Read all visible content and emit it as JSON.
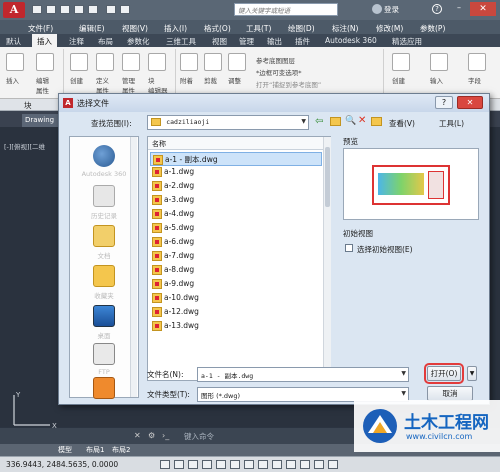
{
  "titlebar": {
    "search_placeholder": "键入关键字或短语",
    "login": "登录"
  },
  "menu": [
    "文件(F)",
    "编辑(E)",
    "视图(V)",
    "插入(I)",
    "格式(O)",
    "工具(T)",
    "绘图(D)",
    "标注(N)",
    "修改(M)",
    "参数(P)"
  ],
  "ribbon_tabs": [
    "默认",
    "插入",
    "注释",
    "布局",
    "参数化",
    "三维工具",
    "视图",
    "管理",
    "输出",
    "插件",
    "Autodesk 360",
    "精选应用"
  ],
  "ribbon_active_tab": "插入",
  "ribbon": {
    "insert": "插入",
    "edit_attr": "编辑\n属性",
    "create": "创建",
    "define_attr": "定义\n属性",
    "manage_attr": "管理\n属性",
    "block_editor": "块\n编辑器",
    "attach": "附着",
    "clip": "剪裁",
    "adjust": "调整",
    "ref_underlay": "参考底图图层",
    "frame_var": "*边框可变选项*",
    "import_text": "打开“捕捉到参考底图”",
    "create2": "创建",
    "import": "输入",
    "field": "字段"
  },
  "panel_block": "块",
  "doc_tab": "Drawing",
  "viewport_label": "[-][俯视][二维",
  "dialog": {
    "title": "选择文件",
    "lookin_label": "查找范围(I):",
    "lookin_value": "cadziliaoji",
    "view_label": "查看(V)",
    "tools_label": "工具(L)",
    "places": [
      {
        "label": "Autodesk 360",
        "icon": "cloud-icon"
      },
      {
        "label": "历史记录",
        "icon": "history-icon"
      },
      {
        "label": "文档",
        "icon": "documents-icon"
      },
      {
        "label": "收藏夹",
        "icon": "favorites-icon"
      },
      {
        "label": "桌面",
        "icon": "desktop-icon"
      },
      {
        "label": "FTP",
        "icon": "ftp-icon"
      }
    ],
    "list_header": "名称",
    "files": [
      "a-1 - 副本.dwg",
      "a-1.dwg",
      "a-2.dwg",
      "a-3.dwg",
      "a-4.dwg",
      "a-5.dwg",
      "a-6.dwg",
      "a-7.dwg",
      "a-8.dwg",
      "a-9.dwg",
      "a-10.dwg",
      "a-12.dwg",
      "a-13.dwg"
    ],
    "selected_index": 0,
    "preview_label": "预览",
    "initial_view_label": "初始视图",
    "select_initial_view": "选择初始视图(E)",
    "filename_label": "文件名(N):",
    "filename_value": "a-1 - 副本.dwg",
    "filetype_label": "文件类型(T):",
    "filetype_value": "图形 (*.dwg)",
    "open_button": "打开(O)",
    "cancel_button": "取消"
  },
  "command_placeholder": "键入命令",
  "layout_tabs": [
    "模型",
    "布局1",
    "布局2"
  ],
  "status_coords": "336.9443, 2484.5635, 0.0000",
  "watermark": {
    "title": "土木工程网",
    "url": "www.civilcn.com"
  },
  "colors": {
    "dark_bg": "#2b3441",
    "dialog_bg": "#dbe6f2",
    "selection": "#cde3f9",
    "highlight": "#e23b3b",
    "brand": "#1565c0"
  }
}
